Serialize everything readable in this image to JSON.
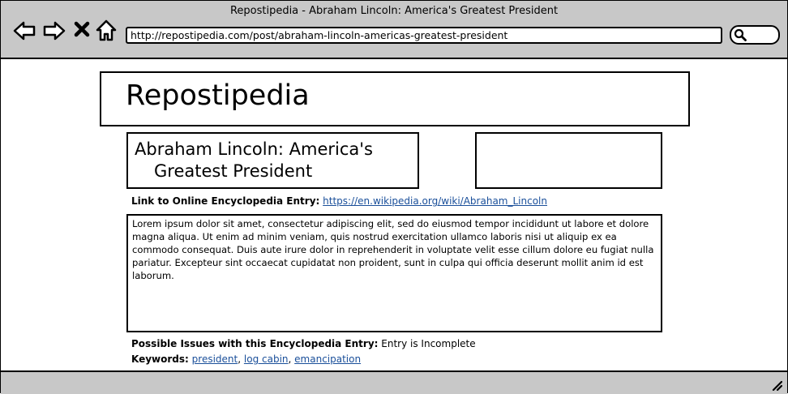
{
  "browser": {
    "window_title": "Repostipedia - Abraham Lincoln: America's Greatest President",
    "url": "http://repostipedia.com/post/abraham-lincoln-americas-greatest-president"
  },
  "site": {
    "name": "Repostipedia"
  },
  "article": {
    "title_line1": "Abraham Lincoln: America's",
    "title_line2": "Greatest President",
    "link_label": "Link to Online Encyclopedia Entry:",
    "link_url": "https://en.wikipedia.org/wiki/Abraham_Lincoln",
    "body": "Lorem ipsum dolor sit amet, consectetur adipiscing elit, sed do eiusmod tempor incididunt ut labore et dolore magna aliqua. Ut enim ad minim veniam, quis nostrud exercitation ullamco laboris nisi ut aliquip ex ea commodo consequat. Duis aute irure dolor in reprehenderit in voluptate velit esse cillum dolore eu fugiat nulla pariatur. Excepteur sint occaecat cupidatat non proident, sunt in culpa qui officia deserunt mollit anim id est laborum.",
    "issues_label": "Possible Issues with this Encyclopedia Entry:",
    "issues_value": "Entry is Incomplete",
    "keywords_label": "Keywords:",
    "keywords": [
      "president",
      "log cabin",
      "emancipation"
    ],
    "keyword_separator": ","
  }
}
